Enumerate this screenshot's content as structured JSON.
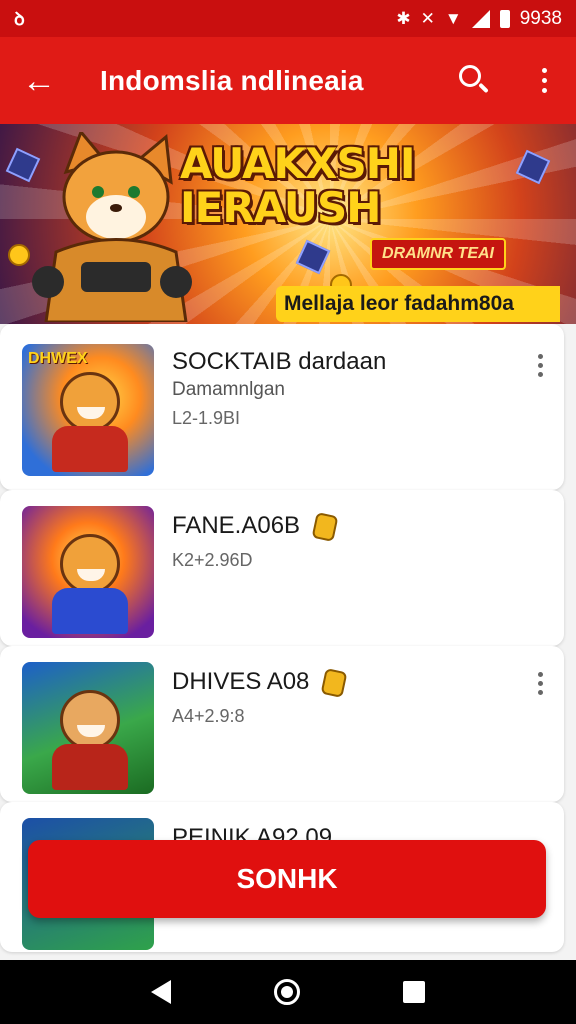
{
  "status_bar": {
    "left": "ꝺ",
    "time": "9938"
  },
  "app_bar": {
    "back_icon": "arrow-left",
    "title": "Indomslia ndlineaia",
    "search_icon": "search",
    "more_icon": "more-vert"
  },
  "banner": {
    "headline_line1": "AUAKXSHI",
    "headline_line2": "IERAUSH",
    "badge": "DRAMNR TEAI",
    "strip": "Mellaja leor fadahm80a"
  },
  "items": [
    {
      "name": "SOCKTAIB dardaan",
      "sub": "Damamnlgan",
      "meta": "L2-1.9BI",
      "thumb_label": "DHWEX"
    },
    {
      "name": "FANE.A06B",
      "meta": "K2+2.96D"
    },
    {
      "name": "DHIVES A08",
      "meta": "A4+2.9:8"
    },
    {
      "name": "PEINIK A92.09"
    }
  ],
  "cta": {
    "label": "SONHK"
  },
  "colors": {
    "primary": "#e01b16",
    "status": "#c90f0f",
    "accent": "#ffd21a"
  }
}
